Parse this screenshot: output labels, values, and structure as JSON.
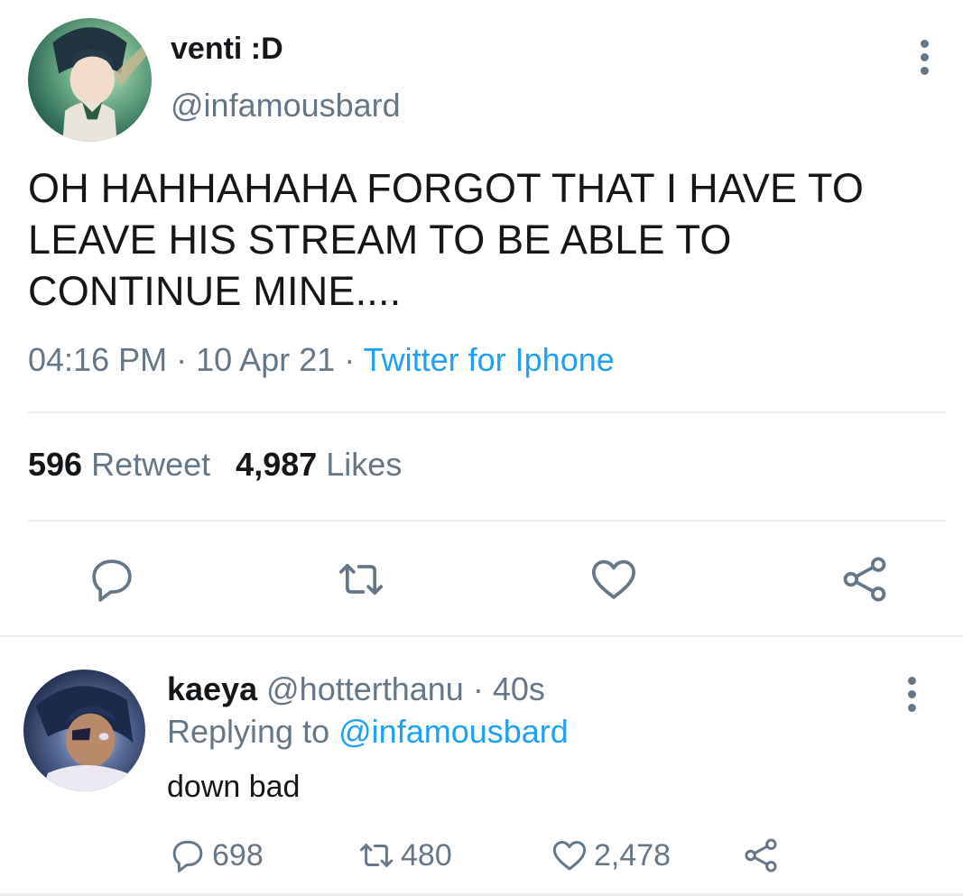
{
  "main_tweet": {
    "display_name": "venti :D",
    "handle": "@infamousbard",
    "text": "OH HAHHAHAHA FORGOT THAT I HAVE TO LEAVE HIS STREAM TO BE ABLE TO CONTINUE MINE....",
    "time": "04:16 PM",
    "date": "10 Apr 21",
    "separator": "·",
    "source": "Twitter for Iphone",
    "retweets_count": "596",
    "retweets_label": "Retweet",
    "likes_count": "4,987",
    "likes_label": "Likes",
    "avatar_icon": "avatar-image",
    "more_icon": "more-vertical-icon"
  },
  "actions": [
    "reply-icon",
    "retweet-icon",
    "like-icon",
    "share-icon"
  ],
  "reply": {
    "display_name": "kaeya",
    "handle": "@hotterthanu",
    "separator": "·",
    "time_ago": "40s",
    "replying_to_label": "Replying to",
    "replying_to_handle": "@infamousbard",
    "text": "down bad",
    "reply_count": "698",
    "retweet_count": "480",
    "like_count": "2,478"
  },
  "colors": {
    "text": "#14171a",
    "secondary": "#657786",
    "accent": "#1da1f2",
    "divider": "#e6ecf0"
  }
}
